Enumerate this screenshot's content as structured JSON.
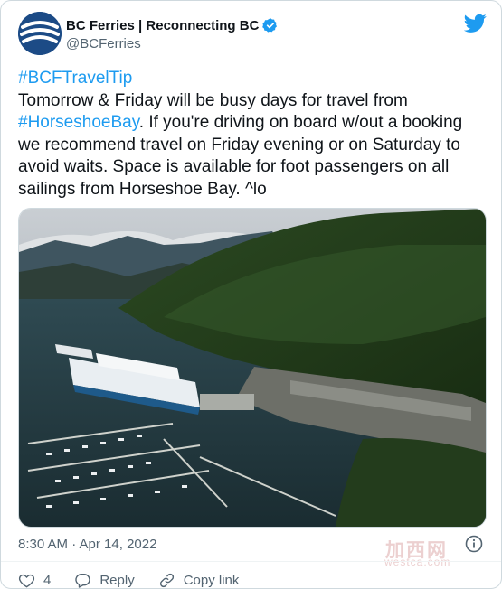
{
  "account": {
    "display_name": "BC Ferries | Reconnecting BC",
    "handle": "@BCFerries"
  },
  "tweet": {
    "hashtag_line": "#BCFTravelTip",
    "text_1": "Tomorrow & Friday will be busy days for travel from ",
    "hashtag_inline": "#HorseshoeBay",
    "text_2": ". If you're driving on board w/out a booking we recommend travel on Friday evening or on Saturday to avoid waits. Space is available for foot passengers on all sailings from Horseshoe Bay. ^lo",
    "timestamp": "8:30 AM · Apr 14, 2022"
  },
  "actions": {
    "like_count": "4",
    "reply_label": "Reply",
    "copy_link_label": "Copy link"
  },
  "watermark": {
    "main": "加西网",
    "sub": "westca.com"
  },
  "colors": {
    "link": "#1d9bf0",
    "verified": "#1d9bf0",
    "avatar_bg": "#1c4b86",
    "text_secondary": "#536471"
  },
  "icons": [
    "bc-ferries-logo-icon",
    "verified-badge-icon",
    "twitter-bird-icon",
    "info-icon",
    "heart-icon",
    "reply-icon",
    "link-icon"
  ]
}
